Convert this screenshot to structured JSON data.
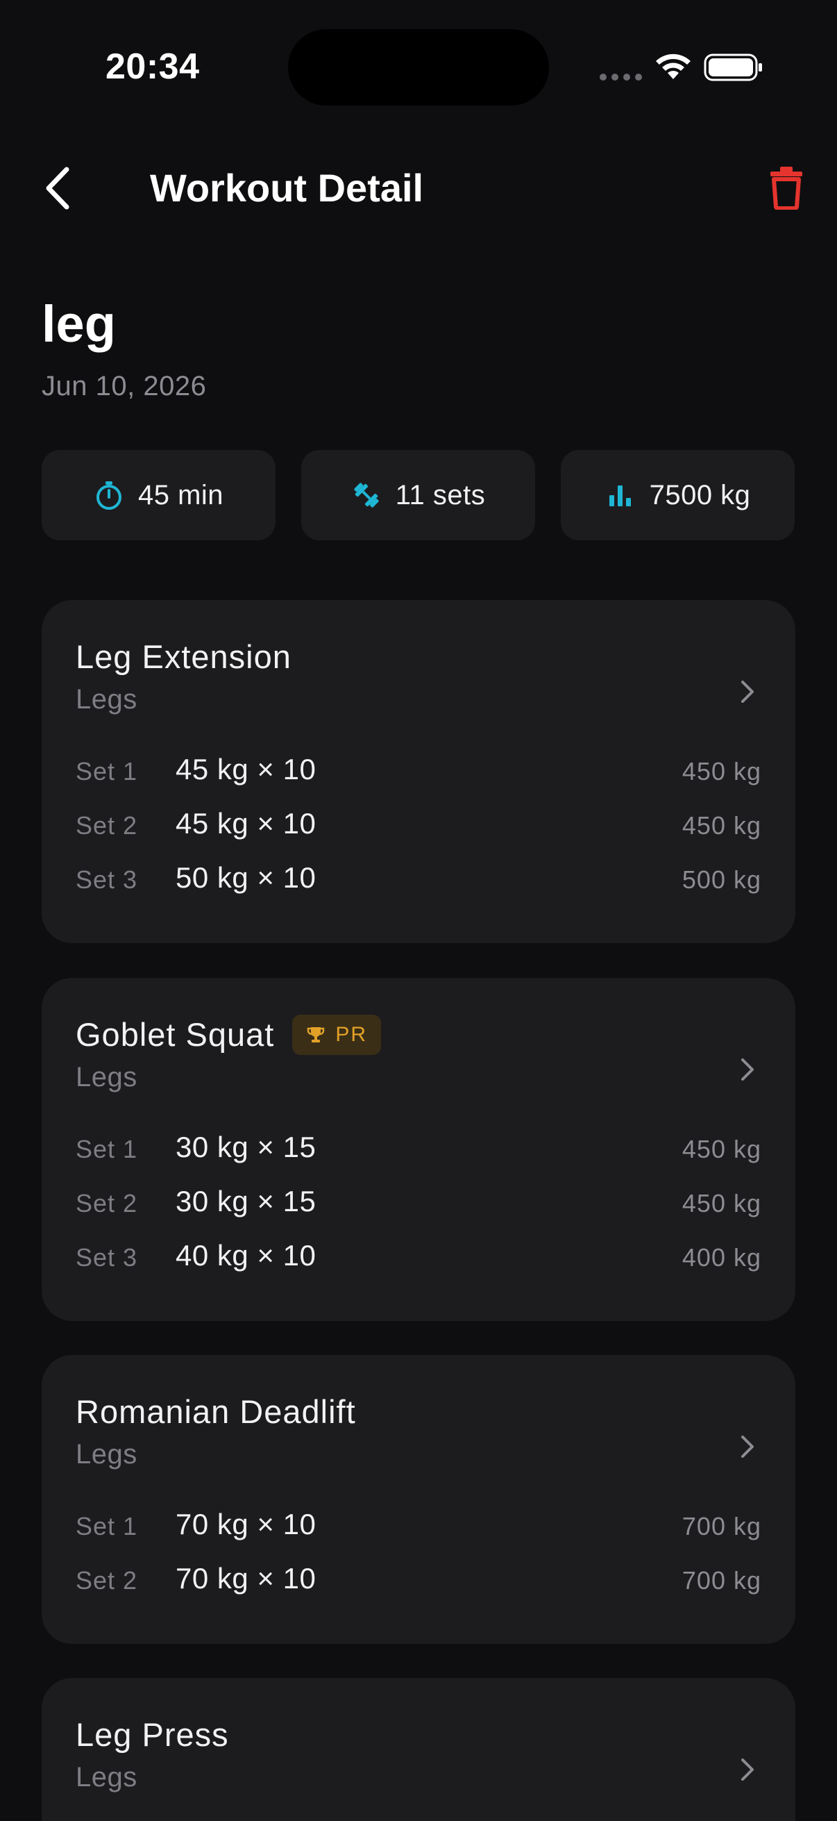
{
  "status_bar": {
    "time": "20:34"
  },
  "nav": {
    "title": "Workout Detail",
    "back_icon": "chevron-left-icon",
    "delete_icon": "trash-icon"
  },
  "workout": {
    "name": "leg",
    "date": "Jun 10, 2026"
  },
  "stats": {
    "duration": "45 min",
    "sets": "11 sets",
    "volume": "7500 kg"
  },
  "colors": {
    "accent": "#1fb6d5",
    "danger": "#e5342e",
    "pr_badge_text": "#e1a128",
    "card_bg": "#1c1c1f",
    "page_bg": "#0e0e10"
  },
  "exercises": [
    {
      "name": "Leg Extension",
      "group": "Legs",
      "sets": [
        {
          "label": "Set 1",
          "detail": "45 kg × 10",
          "volume": "450 kg"
        },
        {
          "label": "Set 2",
          "detail": "45 kg × 10",
          "volume": "450 kg"
        },
        {
          "label": "Set 3",
          "detail": "50 kg × 10",
          "volume": "500 kg"
        }
      ]
    },
    {
      "name": "Goblet Squat",
      "group": "Legs",
      "badge": "PR",
      "sets": [
        {
          "label": "Set 1",
          "detail": "30 kg × 15",
          "volume": "450 kg"
        },
        {
          "label": "Set 2",
          "detail": "30 kg × 15",
          "volume": "450 kg"
        },
        {
          "label": "Set 3",
          "detail": "40 kg × 10",
          "volume": "400 kg"
        }
      ]
    },
    {
      "name": "Romanian Deadlift",
      "group": "Legs",
      "sets": [
        {
          "label": "Set 1",
          "detail": "70 kg × 10",
          "volume": "700 kg"
        },
        {
          "label": "Set 2",
          "detail": "70 kg × 10",
          "volume": "700 kg"
        }
      ]
    },
    {
      "name": "Leg Press",
      "group": "Legs",
      "sets": []
    }
  ]
}
